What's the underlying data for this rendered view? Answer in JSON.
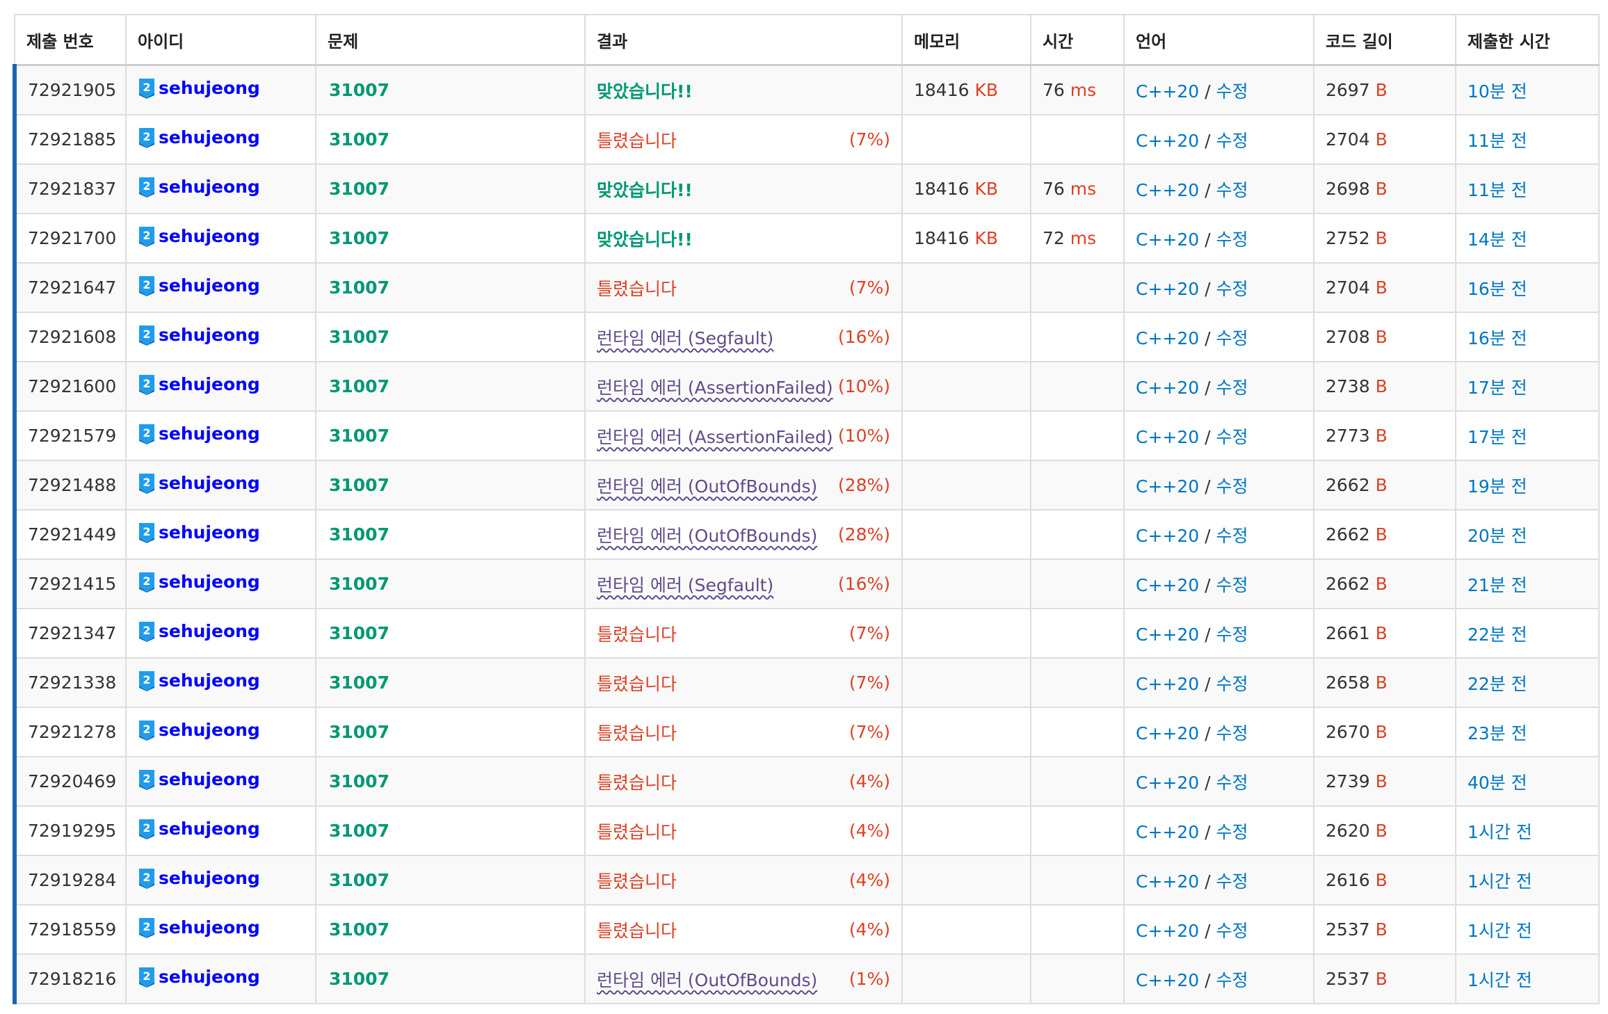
{
  "headers": {
    "id": "제출 번호",
    "user": "아이디",
    "problem": "문제",
    "result": "결과",
    "memory": "메모리",
    "time": "시간",
    "language": "언어",
    "code_length": "코드 길이",
    "submitted": "제출한 시간"
  },
  "units": {
    "memory": "KB",
    "time": "ms",
    "code": "B"
  },
  "colors": {
    "accepted": "#009874",
    "wrong": "#dd4124",
    "runtime_error": "#5f4b8b",
    "link": "#0076c0",
    "user": "#0000ff",
    "row_marker": "#1e63b3"
  },
  "rows": [
    {
      "id": "72921905",
      "user": "sehujeong",
      "problem": "31007",
      "result": "맞았습니다!!",
      "result_type": "ac",
      "score": "",
      "memory": "18416",
      "time": "76",
      "lang": "C++20",
      "edit": "수정",
      "code": "2697",
      "ago": "10분 전"
    },
    {
      "id": "72921885",
      "user": "sehujeong",
      "problem": "31007",
      "result": "틀렸습니다",
      "result_type": "wa",
      "score": "(7%)",
      "memory": "",
      "time": "",
      "lang": "C++20",
      "edit": "수정",
      "code": "2704",
      "ago": "11분 전"
    },
    {
      "id": "72921837",
      "user": "sehujeong",
      "problem": "31007",
      "result": "맞았습니다!!",
      "result_type": "ac",
      "score": "",
      "memory": "18416",
      "time": "76",
      "lang": "C++20",
      "edit": "수정",
      "code": "2698",
      "ago": "11분 전"
    },
    {
      "id": "72921700",
      "user": "sehujeong",
      "problem": "31007",
      "result": "맞았습니다!!",
      "result_type": "ac",
      "score": "",
      "memory": "18416",
      "time": "72",
      "lang": "C++20",
      "edit": "수정",
      "code": "2752",
      "ago": "14분 전"
    },
    {
      "id": "72921647",
      "user": "sehujeong",
      "problem": "31007",
      "result": "틀렸습니다",
      "result_type": "wa",
      "score": "(7%)",
      "memory": "",
      "time": "",
      "lang": "C++20",
      "edit": "수정",
      "code": "2704",
      "ago": "16분 전"
    },
    {
      "id": "72921608",
      "user": "sehujeong",
      "problem": "31007",
      "result": "런타임 에러 (Segfault)",
      "result_type": "rte",
      "score": "(16%)",
      "memory": "",
      "time": "",
      "lang": "C++20",
      "edit": "수정",
      "code": "2708",
      "ago": "16분 전"
    },
    {
      "id": "72921600",
      "user": "sehujeong",
      "problem": "31007",
      "result": "런타임 에러 (AssertionFailed)",
      "result_type": "rte",
      "score": "(10%)",
      "memory": "",
      "time": "",
      "lang": "C++20",
      "edit": "수정",
      "code": "2738",
      "ago": "17분 전"
    },
    {
      "id": "72921579",
      "user": "sehujeong",
      "problem": "31007",
      "result": "런타임 에러 (AssertionFailed)",
      "result_type": "rte",
      "score": "(10%)",
      "memory": "",
      "time": "",
      "lang": "C++20",
      "edit": "수정",
      "code": "2773",
      "ago": "17분 전"
    },
    {
      "id": "72921488",
      "user": "sehujeong",
      "problem": "31007",
      "result": "런타임 에러 (OutOfBounds)",
      "result_type": "rte",
      "score": "(28%)",
      "memory": "",
      "time": "",
      "lang": "C++20",
      "edit": "수정",
      "code": "2662",
      "ago": "19분 전"
    },
    {
      "id": "72921449",
      "user": "sehujeong",
      "problem": "31007",
      "result": "런타임 에러 (OutOfBounds)",
      "result_type": "rte",
      "score": "(28%)",
      "memory": "",
      "time": "",
      "lang": "C++20",
      "edit": "수정",
      "code": "2662",
      "ago": "20분 전"
    },
    {
      "id": "72921415",
      "user": "sehujeong",
      "problem": "31007",
      "result": "런타임 에러 (Segfault)",
      "result_type": "rte",
      "score": "(16%)",
      "memory": "",
      "time": "",
      "lang": "C++20",
      "edit": "수정",
      "code": "2662",
      "ago": "21분 전"
    },
    {
      "id": "72921347",
      "user": "sehujeong",
      "problem": "31007",
      "result": "틀렸습니다",
      "result_type": "wa",
      "score": "(7%)",
      "memory": "",
      "time": "",
      "lang": "C++20",
      "edit": "수정",
      "code": "2661",
      "ago": "22분 전"
    },
    {
      "id": "72921338",
      "user": "sehujeong",
      "problem": "31007",
      "result": "틀렸습니다",
      "result_type": "wa",
      "score": "(7%)",
      "memory": "",
      "time": "",
      "lang": "C++20",
      "edit": "수정",
      "code": "2658",
      "ago": "22분 전"
    },
    {
      "id": "72921278",
      "user": "sehujeong",
      "problem": "31007",
      "result": "틀렸습니다",
      "result_type": "wa",
      "score": "(7%)",
      "memory": "",
      "time": "",
      "lang": "C++20",
      "edit": "수정",
      "code": "2670",
      "ago": "23분 전"
    },
    {
      "id": "72920469",
      "user": "sehujeong",
      "problem": "31007",
      "result": "틀렸습니다",
      "result_type": "wa",
      "score": "(4%)",
      "memory": "",
      "time": "",
      "lang": "C++20",
      "edit": "수정",
      "code": "2739",
      "ago": "40분 전"
    },
    {
      "id": "72919295",
      "user": "sehujeong",
      "problem": "31007",
      "result": "틀렸습니다",
      "result_type": "wa",
      "score": "(4%)",
      "memory": "",
      "time": "",
      "lang": "C++20",
      "edit": "수정",
      "code": "2620",
      "ago": "1시간 전"
    },
    {
      "id": "72919284",
      "user": "sehujeong",
      "problem": "31007",
      "result": "틀렸습니다",
      "result_type": "wa",
      "score": "(4%)",
      "memory": "",
      "time": "",
      "lang": "C++20",
      "edit": "수정",
      "code": "2616",
      "ago": "1시간 전"
    },
    {
      "id": "72918559",
      "user": "sehujeong",
      "problem": "31007",
      "result": "틀렸습니다",
      "result_type": "wa",
      "score": "(4%)",
      "memory": "",
      "time": "",
      "lang": "C++20",
      "edit": "수정",
      "code": "2537",
      "ago": "1시간 전"
    },
    {
      "id": "72918216",
      "user": "sehujeong",
      "problem": "31007",
      "result": "런타임 에러 (OutOfBounds)",
      "result_type": "rte",
      "score": "(1%)",
      "memory": "",
      "time": "",
      "lang": "C++20",
      "edit": "수정",
      "code": "2537",
      "ago": "1시간 전"
    }
  ]
}
